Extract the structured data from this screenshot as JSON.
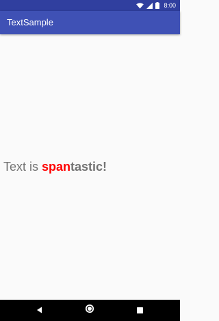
{
  "status_bar": {
    "time": "8:00",
    "icons": [
      "wifi-icon",
      "signal-icon",
      "battery-icon"
    ],
    "color": "#303f9f"
  },
  "app_bar": {
    "title": "TextSample",
    "color": "#3f51b5"
  },
  "content": {
    "text_plain": "Text is ",
    "text_red": "span",
    "text_bold": "tastic!",
    "text_color": "#737373",
    "accent_color": "#ff0000"
  },
  "nav_bar": {
    "buttons": [
      "back-icon",
      "home-icon",
      "recents-icon"
    ]
  }
}
